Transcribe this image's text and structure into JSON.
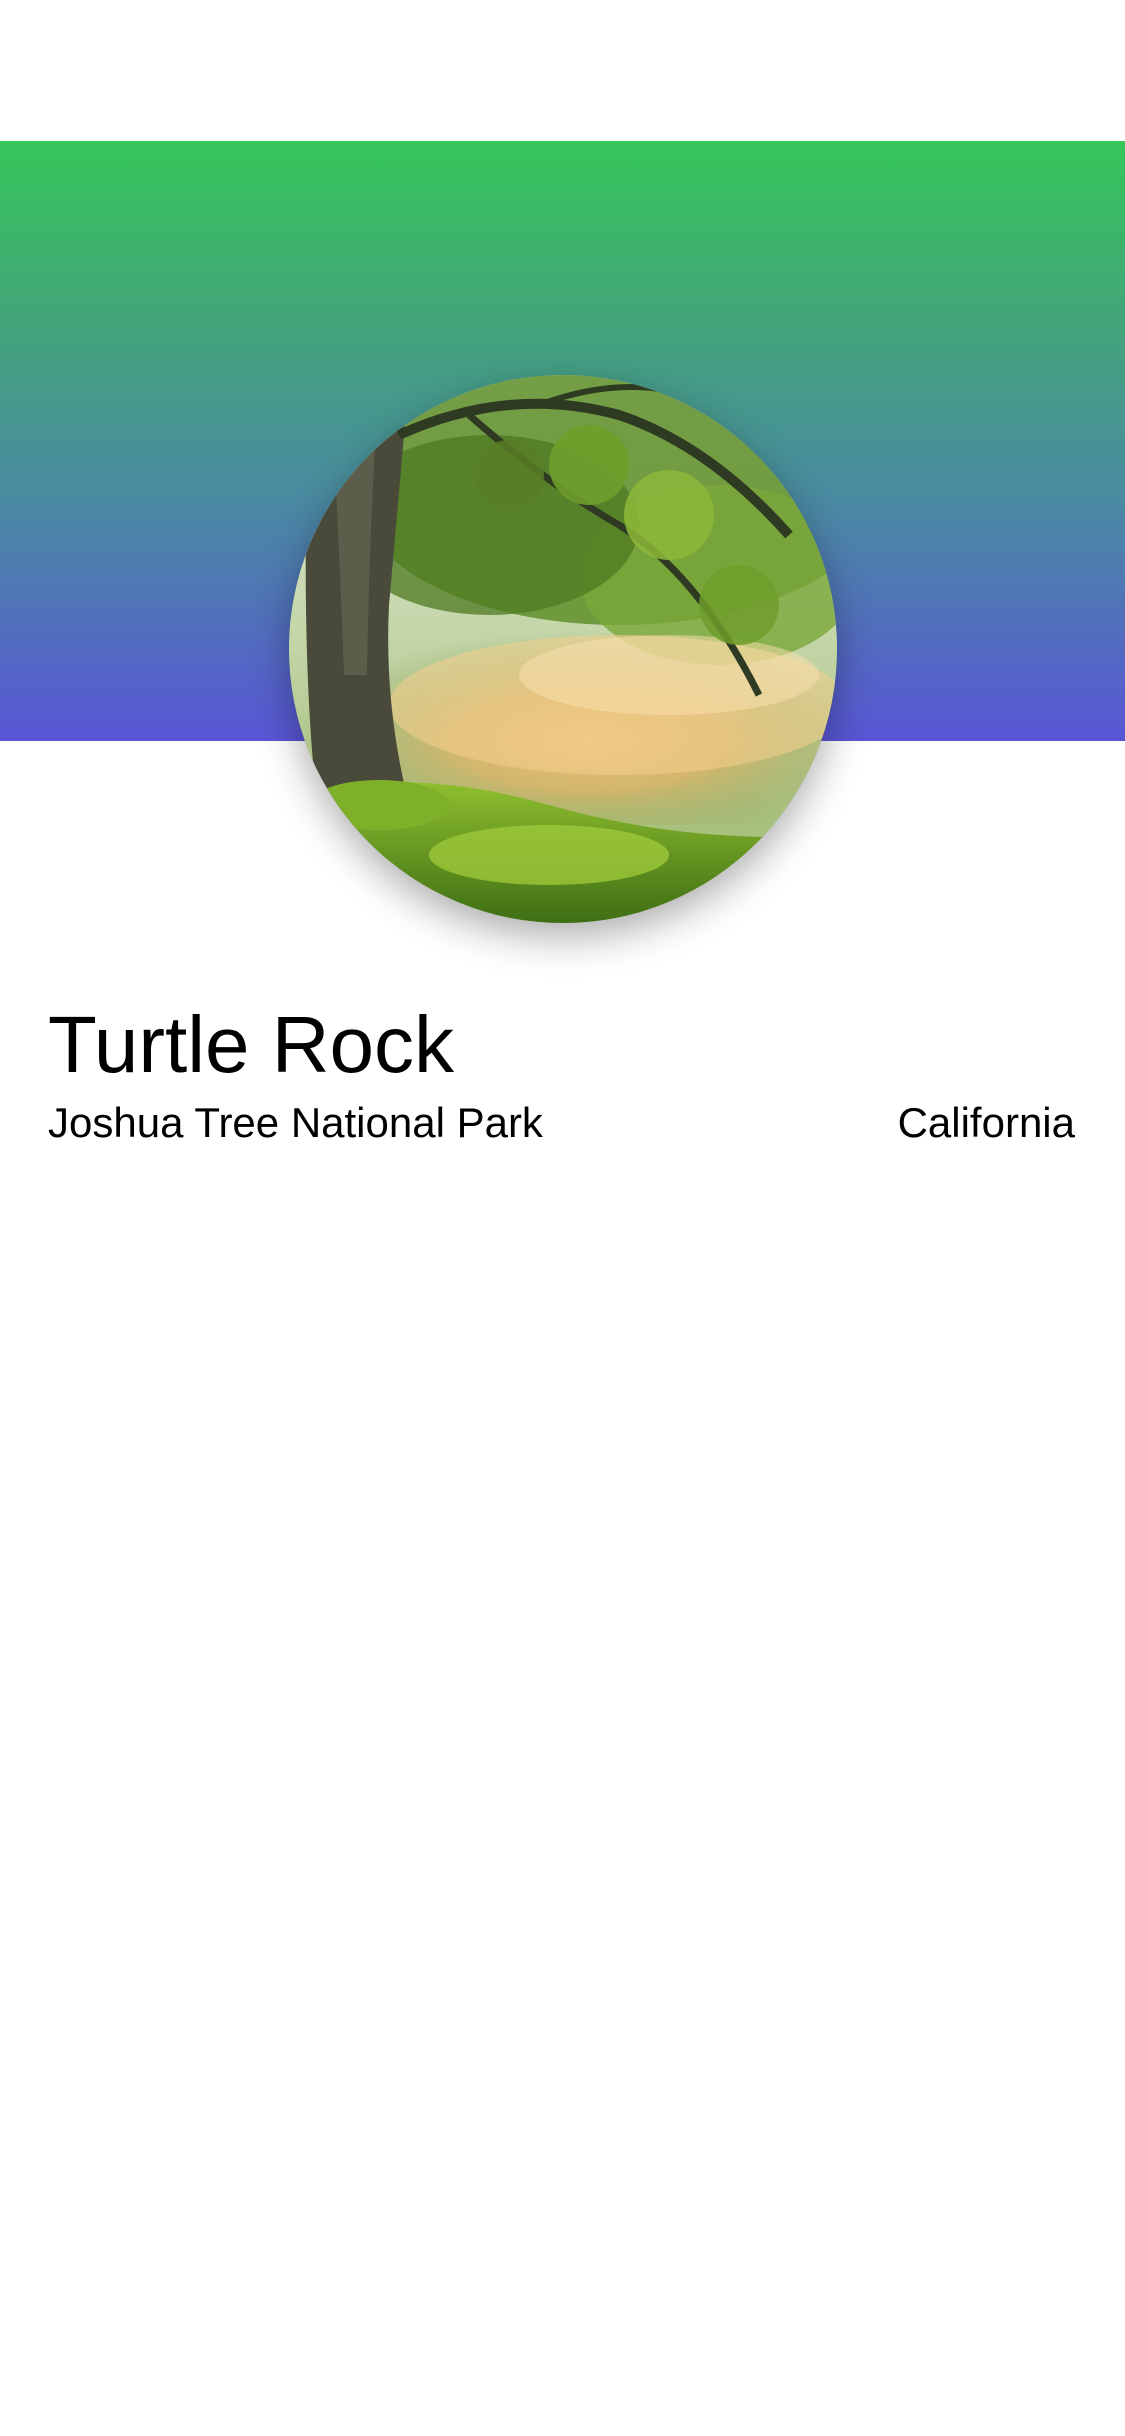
{
  "landmark": {
    "name": "Turtle Rock",
    "park": "Joshua Tree National Park",
    "state": "California"
  },
  "header": {
    "gradient_top": "#35c65a",
    "gradient_bottom": "#5956d6"
  },
  "photo": {
    "subject": "tree-over-misty-river"
  }
}
